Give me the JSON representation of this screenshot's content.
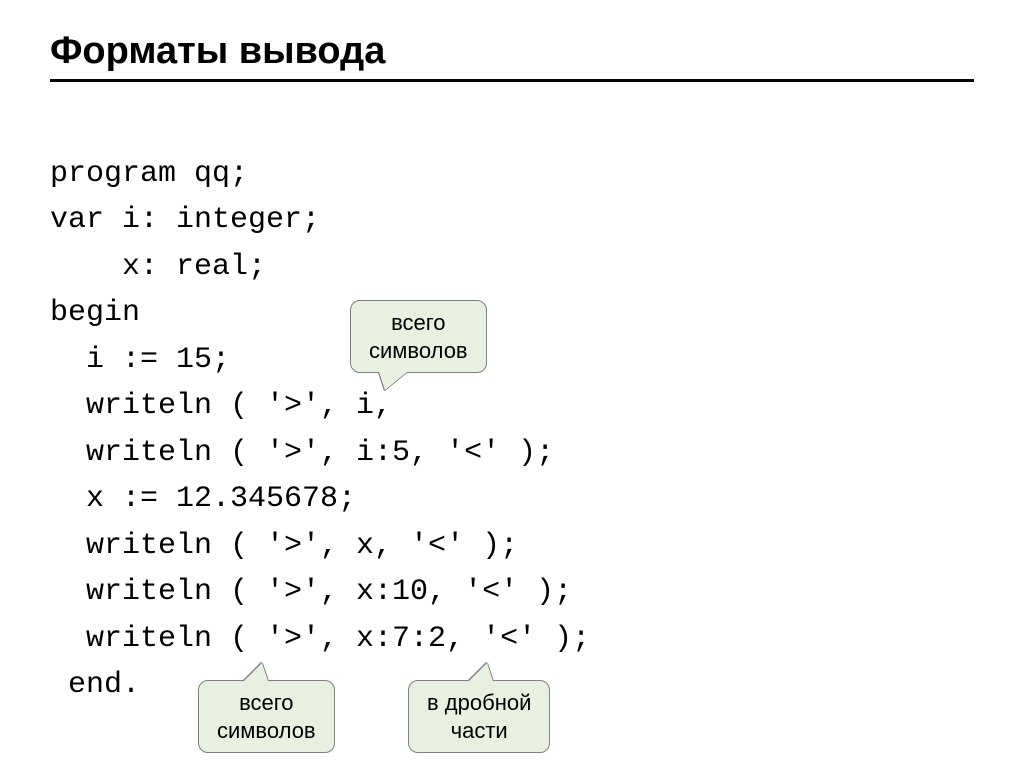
{
  "title": "Форматы вывода",
  "code": {
    "line1": "program qq;",
    "line2": "var i: integer;",
    "line3": "    x: real;",
    "line4": "begin",
    "line5": "  i := 15;",
    "line6": "  writeln ( '>', i,",
    "line7": "  writeln ( '>', i:5, '<' );",
    "line8": "  x := 12.345678;",
    "line9": "  writeln ( '>', x, '<' );",
    "line10": "  writeln ( '>', x:10, '<' );",
    "line11": "  writeln ( '>', x:7:2, '<' );",
    "line12": " end."
  },
  "callouts": {
    "top": "всего\nсимволов",
    "bottom_left": "всего\nсимволов",
    "bottom_right": "в дробной\nчасти"
  }
}
